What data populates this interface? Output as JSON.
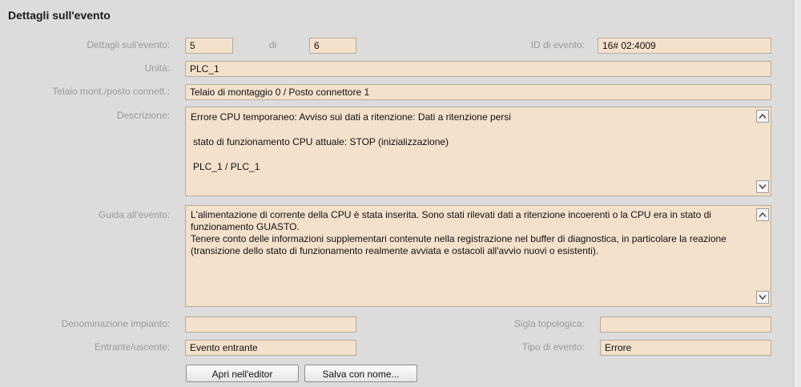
{
  "header": {
    "title": "Dettagli sull'evento"
  },
  "fields": {
    "event_details_label": "Dettagli sull'evento:",
    "event_index": "5",
    "of_label": "di",
    "event_total": "6",
    "event_id_label": "ID di evento:",
    "event_id": "16# 02:4009",
    "unit_label": "Unità:",
    "unit": "PLC_1",
    "rack_slot_label": "Telaio mont./posto connett.:",
    "rack_slot": "Telaio di montaggio 0 / Posto connettore 1",
    "description_label": "Descrizione:",
    "description_lines": [
      "Errore CPU temporaneo: Avviso sui dati a ritenzione: Dati a ritenzione persi",
      "stato di funzionamento CPU attuale: STOP (inizializzazione)",
      "PLC_1 / PLC_1"
    ],
    "guide_label": "Guida all'evento:",
    "guide_text": "L'alimentazione di corrente della CPU è stata inserita. Sono stati rilevati dati a ritenzione incoerenti o la CPU era in stato di funzionamento GUASTO.\nTenere conto delle informazioni supplementari contenute nella registrazione nel buffer di diagnostica, in particolare la reazione (transizione dello stato di funzionamento realmente avviata e ostacoli all'avvio nuovi o esistenti).",
    "plant_name_label": "Denominazione impianto:",
    "plant_name": "",
    "topology_label": "Sigla topologica:",
    "topology": "",
    "incoming_label": "Entrante/uscente:",
    "incoming": "Evento entrante",
    "event_type_label": "Tipo di evento:",
    "event_type": "Errore"
  },
  "buttons": {
    "open_editor": "Apri nell'editor",
    "save_as": "Salva con nome..."
  },
  "icons": {
    "scroll_up": "chevron-up-icon",
    "scroll_down": "chevron-down-icon"
  },
  "colors": {
    "field_bg": "#f3e1cc",
    "panel_bg": "#dcdcdc"
  }
}
